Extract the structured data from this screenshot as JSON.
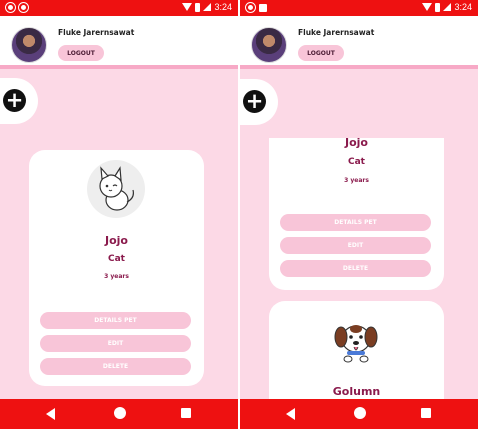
{
  "status_bar": {
    "time": "3:24"
  },
  "header": {
    "username": "Fluke Jarernsawat",
    "logout_label": "LOGOUT"
  },
  "add_button": {
    "icon": "plus-icon"
  },
  "pets": [
    {
      "name": "Jojo",
      "type": "Cat",
      "age": "3 years",
      "image": "cat-illustration"
    },
    {
      "name": "Golumn",
      "image": "dog-illustration"
    }
  ],
  "card_actions": {
    "details_label": "DETAILS PET",
    "edit_label": "EDIT",
    "delete_label": "DELETE"
  },
  "colors": {
    "status_bar": "#ee1111",
    "background": "#fcd9e6",
    "button": "#f8c5d8",
    "accent_text": "#8a1a4c"
  }
}
